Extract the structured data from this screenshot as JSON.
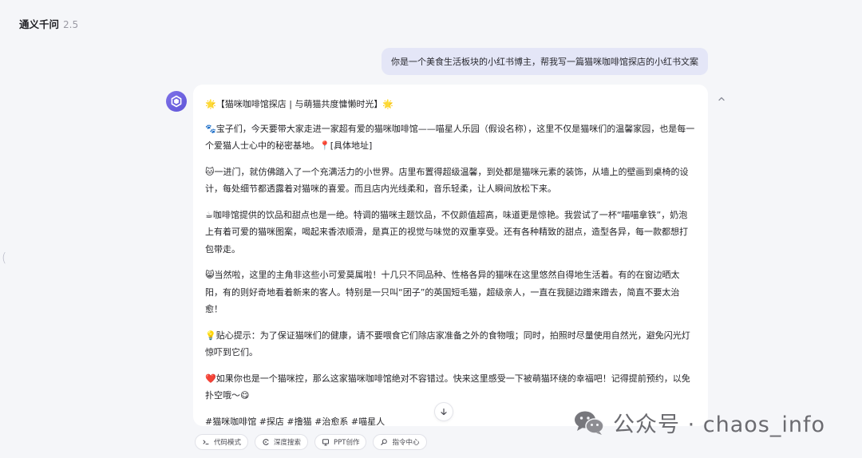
{
  "header": {
    "app_name": "通义千问",
    "version": "2.5"
  },
  "left_handle": "(",
  "user_message": "你是一个美食生活板块的小红书博主，帮我写一篇猫咪咖啡馆探店的小红书文案",
  "assistant": {
    "paragraphs": [
      "🌟【猫咪咖啡馆探店 | 与萌猫共度慵懒时光】🌟",
      "🐾宝子们，今天要带大家走进一家超有爱的猫咪咖啡馆——喵星人乐园（假设名称），这里不仅是猫咪们的温馨家园，也是每一个爱猫人士心中的秘密基地。📍[具体地址]",
      "🐱一进门，就仿佛踏入了一个充满活力的小世界。店里布置得超级温馨，到处都是猫咪元素的装饰，从墙上的壁画到桌椅的设计，每处细节都透露着对猫咪的喜爱。而且店内光线柔和，音乐轻柔，让人瞬间放松下来。",
      "☕咖啡馆提供的饮品和甜点也是一绝。特调的猫咪主题饮品，不仅颜值超高，味道更是惊艳。我尝试了一杯“喵喵拿铁”，奶泡上有着可爱的猫咪图案，喝起来香浓顺滑，是真正的视觉与味觉的双重享受。还有各种精致的甜点，造型各异，每一款都想打包带走。",
      "😸当然啦，这里的主角非这些小可爱莫属啦！十几只不同品种、性格各异的猫咪在这里悠然自得地生活着。有的在窗边晒太阳，有的则好奇地看着新来的客人。特别是一只叫“团子”的英国短毛猫，超级亲人，一直在我腿边蹭来蹭去，简直不要太治愈！",
      "💡贴心提示：为了保证猫咪们的健康，请不要喂食它们除店家准备之外的食物哦；同时，拍照时尽量使用自然光，避免闪光灯惊吓到它们。",
      "❤️如果你也是一个猫咪控，那么这家猫咪咖啡馆绝对不容错过。快来这里感受一下被萌猫环绕的幸福吧！记得提前预约，以免扑空哦～😋"
    ],
    "tags": "#猫咪咖啡馆 #探店 #撸猫 #治愈系 #喵星人"
  },
  "toolbar": {
    "chips": [
      "代码模式",
      "深度搜索",
      "PPT创作",
      "指令中心"
    ]
  },
  "watermark": {
    "text": "公众号 · chaos_info"
  },
  "colors": {
    "background": "#f5f6f9",
    "user_bubble": "#e4e6f7",
    "brand_purple": "#6b5fe0",
    "card": "#ffffff"
  },
  "icons": {
    "avatar": "qwen-logo-icon",
    "collapse": "chevron-up-icon",
    "scroll": "arrow-down-icon",
    "chips": [
      "code-icon",
      "search-icon",
      "ppt-icon",
      "command-icon"
    ],
    "watermark": "wechat-icon"
  }
}
